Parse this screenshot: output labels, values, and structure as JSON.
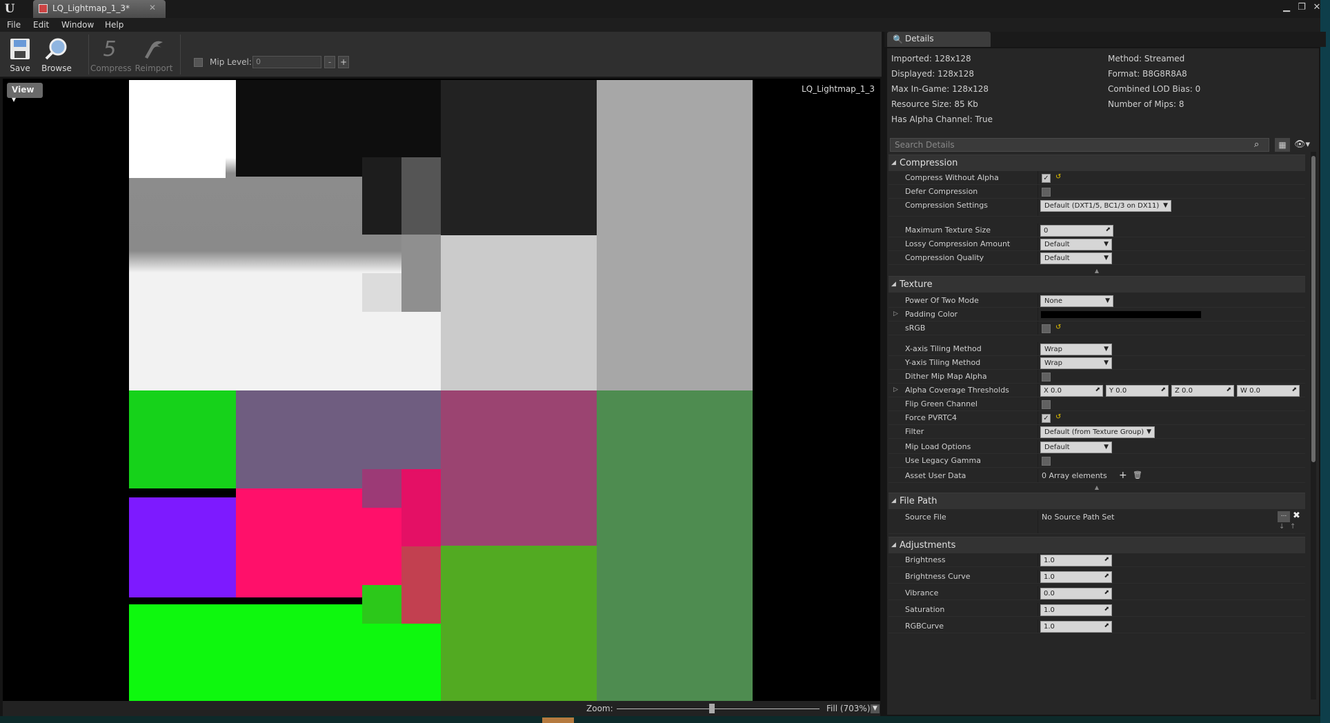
{
  "window": {
    "tab_title": "LQ_Lightmap_1_3*",
    "min": "▁",
    "max": "❐",
    "close": "✕"
  },
  "menu": [
    "File",
    "Edit",
    "Window",
    "Help"
  ],
  "toolbar": {
    "save": "Save",
    "browse": "Browse",
    "compress": "Compress",
    "reimport": "Reimport",
    "mip_label": "Mip Level:",
    "mip_value": "0",
    "minus": "-",
    "plus": "+"
  },
  "viewport": {
    "view_button": "View",
    "asset_name": "LQ_Lightmap_1_3"
  },
  "zoom": {
    "label": "Zoom:",
    "value": "Fill (703%)",
    "level": 0.47
  },
  "details": {
    "tab": "Details",
    "info": {
      "imported": "Imported: 128x128",
      "displayed": "Displayed: 128x128",
      "max_ingame": "Max In-Game: 128x128",
      "resource": "Resource Size: 85 Kb",
      "alpha": "Has Alpha Channel: True",
      "method": "Method: Streamed",
      "format": "Format: B8G8R8A8",
      "lod_bias": "Combined LOD Bias: 0",
      "mips": "Number of Mips: 8"
    },
    "search_placeholder": "Search Details",
    "compression": {
      "title": "Compression",
      "compress_without_alpha": "Compress Without Alpha",
      "defer": "Defer Compression",
      "settings": "Compression Settings",
      "settings_value": "Default (DXT1/5, BC1/3 on DX11)",
      "max_size": "Maximum Texture Size",
      "max_size_value": "0",
      "lossy": "Lossy Compression Amount",
      "lossy_value": "Default",
      "quality": "Compression Quality",
      "quality_value": "Default"
    },
    "texture": {
      "title": "Texture",
      "pot": "Power Of Two Mode",
      "pot_value": "None",
      "padding": "Padding Color",
      "srgb": "sRGB",
      "xtile": "X-axis Tiling Method",
      "xtile_value": "Wrap",
      "ytile": "Y-axis Tiling Method",
      "ytile_value": "Wrap",
      "dither": "Dither Mip Map Alpha",
      "alpha_cov": "Alpha Coverage Thresholds",
      "ax": "X",
      "ay": "Y",
      "az": "Z",
      "aw": "W",
      "axv": "0.0",
      "ayv": "0.0",
      "azv": "0.0",
      "awv": "0.0",
      "flip": "Flip Green Channel",
      "pvrtc": "Force PVRTC4",
      "filter": "Filter",
      "filter_value": "Default (from Texture Group)",
      "mip_load": "Mip Load Options",
      "mip_load_value": "Default",
      "legacy": "Use Legacy Gamma",
      "user_data": "Asset User Data",
      "user_data_value": "0 Array elements"
    },
    "filepath": {
      "title": "File Path",
      "source": "Source File",
      "source_value": "No Source Path Set",
      "browse": "..."
    },
    "adjust": {
      "title": "Adjustments",
      "brightness": "Brightness",
      "brightness_v": "1.0",
      "curve": "Brightness Curve",
      "curve_v": "1.0",
      "vibrance": "Vibrance",
      "vibrance_v": "0.0",
      "saturation": "Saturation",
      "saturation_v": "1.0",
      "rgbcurve": "RGBCurve",
      "rgbcurve_v": "1.0"
    }
  }
}
